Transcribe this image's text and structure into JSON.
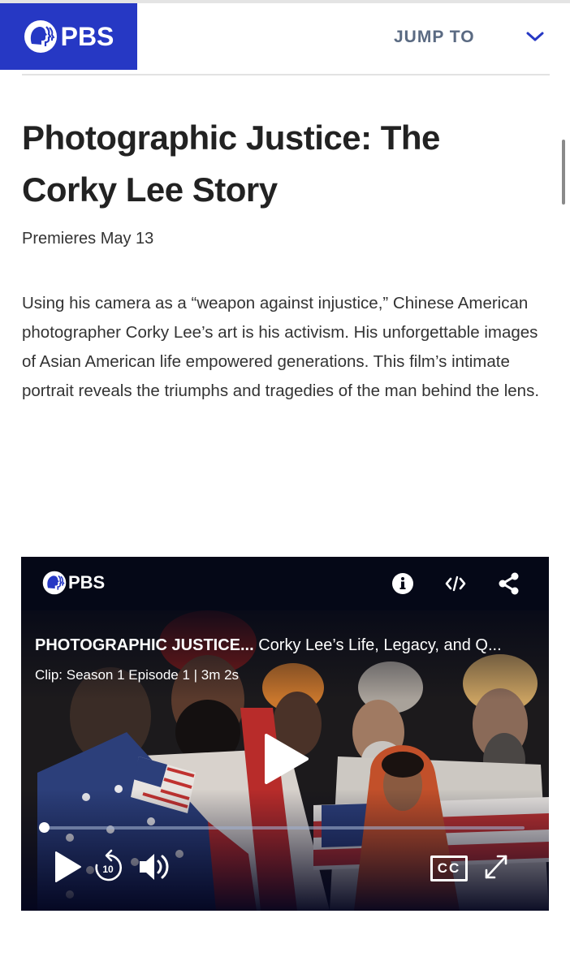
{
  "header": {
    "brand": "PBS",
    "brand_color": "#2638c4",
    "jump_to_label": "JUMP TO",
    "jump_to_icon": "chevron-down-icon"
  },
  "page": {
    "title": "Photographic Justice: The Corky Lee Story",
    "premiere": "Premieres May 13",
    "description": "Using his camera as a “weapon against injustice,” Chinese American photographer Corky Lee’s art is his activism. His unforgettable images of Asian American life empowered generations. This film’s intimate portrait reveals the triumphs and tragedies of the man behind the lens."
  },
  "player": {
    "brand": "PBS",
    "toolbar_icons": [
      "info-icon",
      "embed-code-icon",
      "share-icon"
    ],
    "show_title": "PHOTOGRAPHIC JUSTICE...",
    "clip_title": "Corky Lee’s Life, Legacy, and Q...",
    "clip_meta": "Clip: Season 1 Episode 1 | 3m 2s",
    "skip_back_seconds": "10",
    "cc_label": "CC",
    "progress_fraction": 0.0,
    "controls": [
      "play-icon",
      "rewind-10-icon",
      "volume-icon",
      "closed-captions-icon",
      "fullscreen-icon"
    ]
  }
}
